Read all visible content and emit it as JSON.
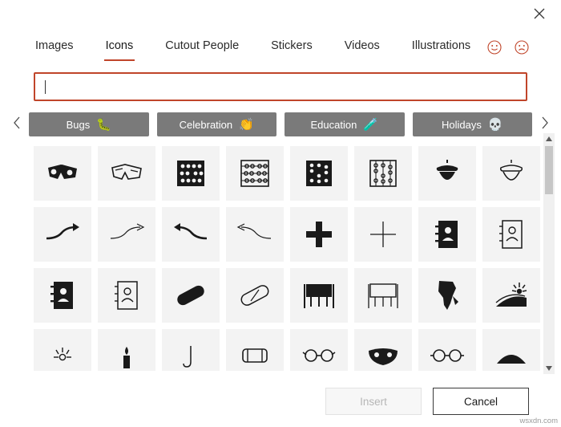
{
  "window": {
    "close_icon": "close-icon"
  },
  "tabs": [
    {
      "label": "Images",
      "active": false
    },
    {
      "label": "Icons",
      "active": true
    },
    {
      "label": "Cutout People",
      "active": false
    },
    {
      "label": "Stickers",
      "active": false
    },
    {
      "label": "Videos",
      "active": false
    },
    {
      "label": "Illustrations",
      "active": false
    }
  ],
  "feedback": {
    "happy_icon": "smiley-face-icon",
    "sad_icon": "frowning-face-icon"
  },
  "search": {
    "value": "",
    "placeholder": ""
  },
  "categories": {
    "prev_arrow": "chevron-left-icon",
    "next_arrow": "chevron-right-icon",
    "chips": [
      {
        "label": "Bugs",
        "emoji": "🐛"
      },
      {
        "label": "Celebration",
        "emoji": "👏"
      },
      {
        "label": "Education",
        "emoji": "🧪"
      },
      {
        "label": "Holidays",
        "emoji": "💀"
      }
    ]
  },
  "grid": {
    "icons": [
      "3d-glasses-icon",
      "3d-glasses-alt-icon",
      "abacus-filled-icon",
      "abacus-outline-icon",
      "abacus-vertical-filled-icon",
      "abacus-vertical-outline-icon",
      "acorn-filled-icon",
      "acorn-outline-icon",
      "arrow-curve-right-icon",
      "arrow-curve-right-thin-icon",
      "arrow-curve-left-icon",
      "arrow-curve-left-thin-icon",
      "plus-bold-icon",
      "plus-thin-icon",
      "address-book-filled-icon",
      "address-book-outline-icon",
      "contact-card-filled-icon",
      "contact-card-outline-icon",
      "bandage-filled-icon",
      "bandage-outline-icon",
      "easel-filled-icon",
      "easel-outline-icon",
      "africa-map-icon",
      "field-sunrise-icon",
      "sun-partial-icon",
      "candle-icon",
      "hook-icon",
      "clamp-icon",
      "glasses-partial-icon",
      "mask-partial-icon",
      "goggles-partial-icon",
      "dome-partial-icon"
    ]
  },
  "scrollbar": {
    "up_arrow": "scroll-up-arrow-icon",
    "down_arrow": "scroll-down-arrow-icon"
  },
  "footer": {
    "insert_label": "Insert",
    "cancel_label": "Cancel"
  },
  "watermark": "wsxdn.com"
}
